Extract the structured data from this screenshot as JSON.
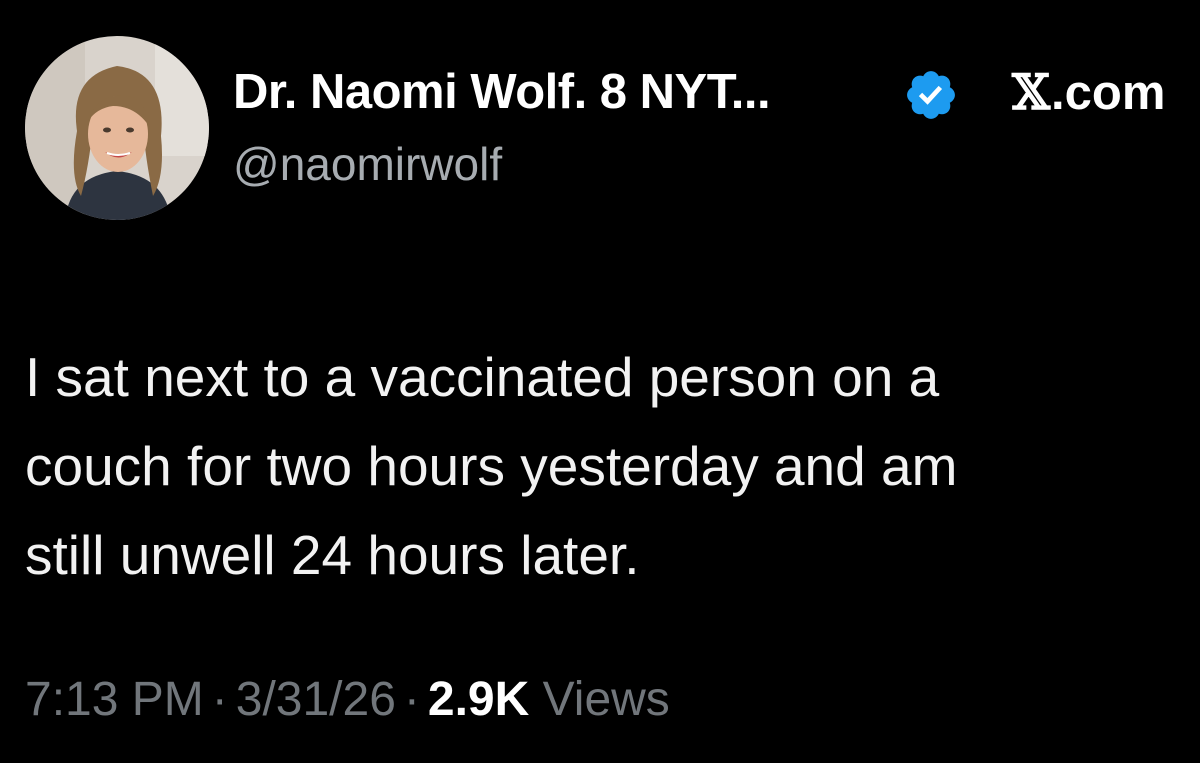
{
  "tweet": {
    "author": {
      "display_name": "Dr. Naomi Wolf. 8 NYT...",
      "handle": "@naomirwolf",
      "verified_icon": "verified-check-badge-icon",
      "avatar": "avatar-photo"
    },
    "source": {
      "logo": "𝕏",
      "domain": ".com"
    },
    "text_lines": [
      "I sat next to a vaccinated person on a",
      "couch for two hours yesterday and am",
      "still unwell 24 hours later."
    ],
    "meta": {
      "time": "7:13 PM",
      "separator": "·",
      "date": "3/31/26",
      "views_count": "2.9K",
      "views_label": "Views"
    }
  },
  "colors": {
    "background": "#000000",
    "text_primary": "#e7e9ea",
    "text_secondary": "#71767b",
    "verified_blue": "#1d9bf0"
  }
}
